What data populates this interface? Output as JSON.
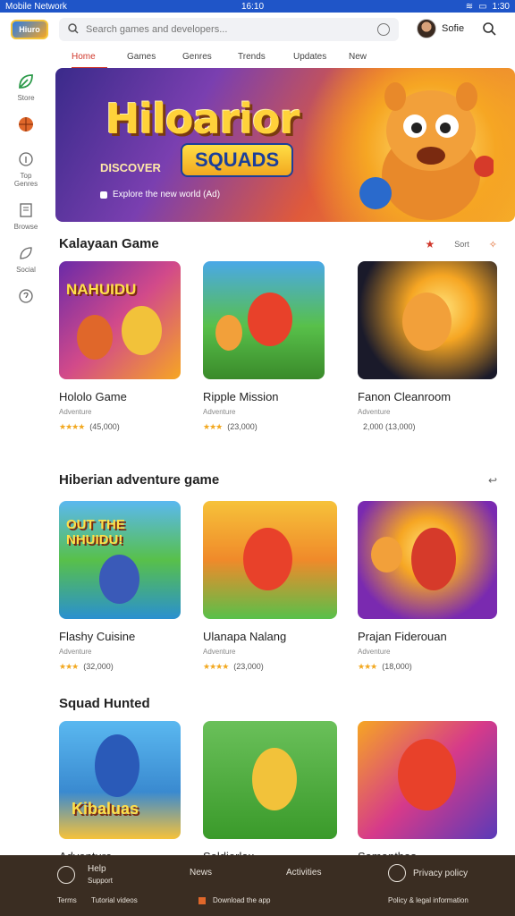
{
  "status": {
    "left": "Mobile Network",
    "center": "16:10",
    "right": "1:30"
  },
  "app": {
    "logo_text": "Hiuro"
  },
  "search": {
    "placeholder": "Search games and developers..."
  },
  "user": {
    "name": "Sofie"
  },
  "tabs": [
    "Home",
    "Games",
    "Genres",
    "Trends",
    "Updates",
    "New"
  ],
  "sidenav": [
    {
      "label": "Store",
      "icon": "leaf-icon"
    },
    {
      "label": "",
      "icon": "basketball-icon"
    },
    {
      "label": "Top Genres",
      "icon": "info-icon"
    },
    {
      "label": "Browse",
      "icon": "document-icon"
    },
    {
      "label": "Social",
      "icon": "leaf-outline-icon"
    },
    {
      "label": "",
      "icon": "help-icon"
    }
  ],
  "hero": {
    "title": "Hiloarior",
    "subtitle": "SQUADS",
    "tag": "DISCOVER",
    "caption": "Explore the new world (Ad)"
  },
  "section1": {
    "title": "Kalayaan Game",
    "action": "Sort"
  },
  "section2": {
    "title": "Hiberian adventure game"
  },
  "section3": {
    "title": "Squad Hunted"
  },
  "cards1": [
    {
      "name": "Hololo Game",
      "sub": "Adventure",
      "stars": "★★★★",
      "count": "(45,000)",
      "word": "NAHUIDU"
    },
    {
      "name": "Ripple Mission",
      "sub": "Adventure",
      "stars": "★★★",
      "count": "(23,000)",
      "word": ""
    },
    {
      "name": "Fanon Cleanroom",
      "sub": "Adventure",
      "stars": "",
      "count": "2,000 (13,000)",
      "word": ""
    }
  ],
  "cards2": [
    {
      "name": "Flashy Cuisine",
      "sub": "Adventure",
      "stars": "★★★",
      "count": "(32,000)",
      "word": "OUT THE NHUIDU!"
    },
    {
      "name": "Ulanapa Nalang",
      "sub": "Adventure",
      "stars": "★★★★",
      "count": "(23,000)",
      "word": ""
    },
    {
      "name": "Prajan Fiderouan",
      "sub": "Adventure",
      "stars": "★★★",
      "count": "(18,000)",
      "word": ""
    }
  ],
  "cards3": [
    {
      "name": "Adventure",
      "word": "Kibaluas"
    },
    {
      "name": "Soldierlax",
      "word": ""
    },
    {
      "name": "Samanthas",
      "word": ""
    }
  ],
  "footer": {
    "help": "Help",
    "help_sub": "Support",
    "news": "News",
    "news_sub": "Tutorial videos",
    "bottom_left": "Terms",
    "activities": "Activities",
    "download": "Download the app",
    "policy": "Privacy policy",
    "privacy_detail": "Policy & legal information"
  }
}
